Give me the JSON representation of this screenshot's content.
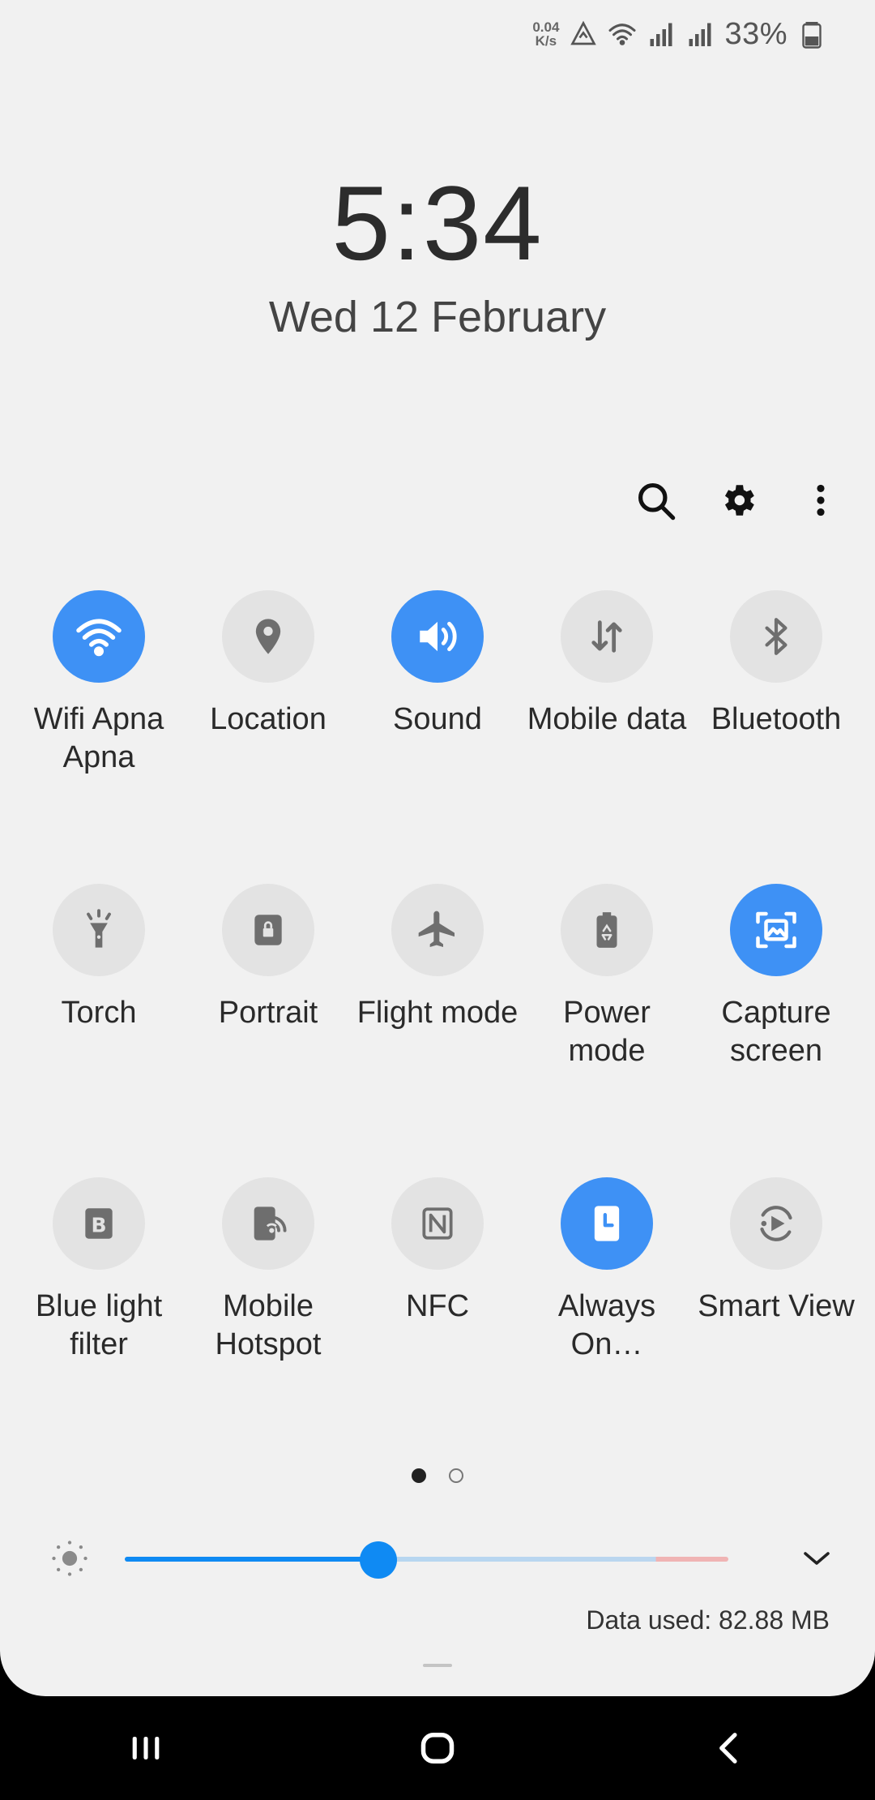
{
  "status": {
    "net_speed_value": "0.04",
    "net_speed_unit": "K/s",
    "battery": "33%"
  },
  "clock": {
    "time": "5:34",
    "date": "Wed 12 February"
  },
  "tiles": [
    {
      "label": "Wifi Apna Apna",
      "icon": "wifi-icon",
      "active": true
    },
    {
      "label": "Location",
      "icon": "location-pin-icon",
      "active": false
    },
    {
      "label": "Sound",
      "icon": "speaker-icon",
      "active": true
    },
    {
      "label": "Mobile data",
      "icon": "data-arrows-icon",
      "active": false
    },
    {
      "label": "Bluetooth",
      "icon": "bluetooth-icon",
      "active": false
    },
    {
      "label": "Torch",
      "icon": "flashlight-icon",
      "active": false
    },
    {
      "label": "Portrait",
      "icon": "rotation-lock-icon",
      "active": false
    },
    {
      "label": "Flight mode",
      "icon": "airplane-icon",
      "active": false
    },
    {
      "label": "Power mode",
      "icon": "battery-recycle-icon",
      "active": false
    },
    {
      "label": "Capture screen",
      "icon": "screenshot-icon",
      "active": true
    },
    {
      "label": "Blue light filter",
      "icon": "blue-light-icon",
      "active": false
    },
    {
      "label": "Mobile Hotspot",
      "icon": "hotspot-icon",
      "active": false
    },
    {
      "label": "NFC",
      "icon": "nfc-icon",
      "active": false
    },
    {
      "label": "Always On…",
      "icon": "always-on-display-icon",
      "active": true
    },
    {
      "label": "Smart View",
      "icon": "smart-view-icon",
      "active": false
    }
  ],
  "pager": {
    "pages": 2,
    "current": 1
  },
  "brightness": {
    "level_percent": 42
  },
  "data_used": "Data used: 82.88 MB",
  "colors": {
    "accent": "#3e91f5",
    "slider": "#0f8af3",
    "panel_bg": "#f1f1f1",
    "nav_bg": "#000000"
  }
}
